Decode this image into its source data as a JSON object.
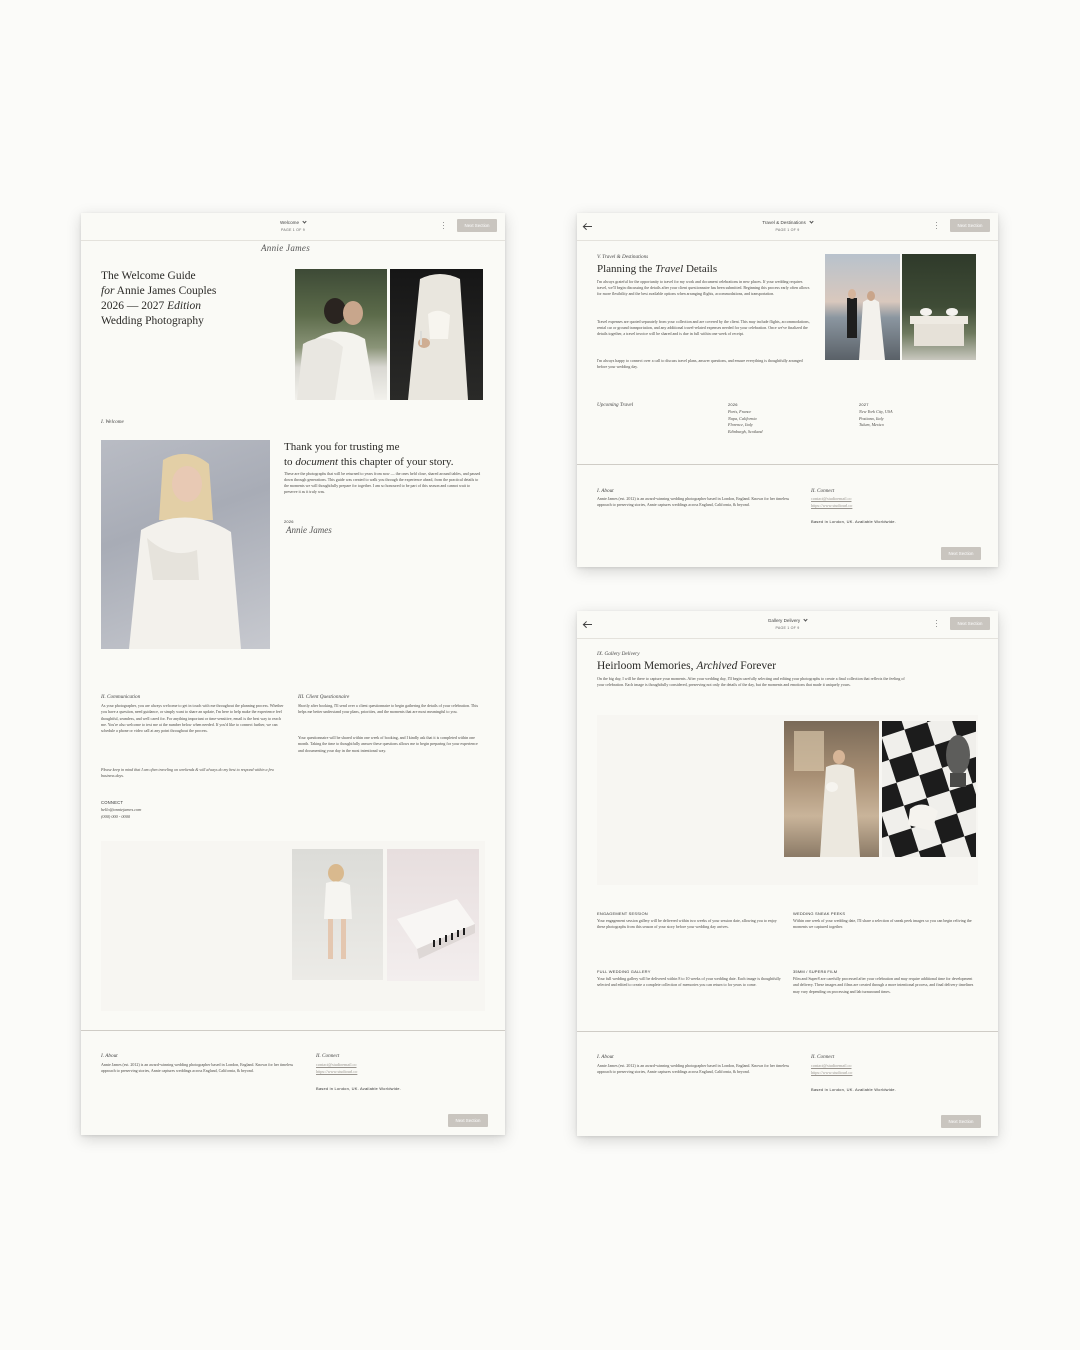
{
  "panels": {
    "welcome": {
      "header": {
        "title": "Welcome",
        "page": "PAGE 1 OF 9",
        "next_label": "Next Section"
      },
      "signature_logo": "Annie James",
      "hero": {
        "line1": "The Welcome Guide",
        "line2_italic": "for",
        "line2_rest": " Annie James Couples",
        "line3_plain": "2026 — 2027 ",
        "line3_italic": "Edition",
        "line4": "Wedding Photography"
      },
      "welcome_label": "I. Welcome",
      "thank_you": {
        "line1": "Thank you for trusting me",
        "line2_pre": "to ",
        "line2_italic": "document",
        "line2_post": " this chapter of your story.",
        "body": "These are the photographs that will be returned to years from now — the ones held close, shared around tables, and passed down through generations. This guide was created to walk you through the experience ahead, from the practical details to the moments we will thoughtfully prepare for together. I am so honoured to be part of this season and cannot wait to preserve it as it truly was.",
        "year": "2026",
        "signature": "Annie James"
      },
      "communication": {
        "label": "II. Communication",
        "body": "As your photographer, you are always welcome to get in touch with me throughout the planning process. Whether you have a question, need guidance, or simply want to share an update, I'm here to help make the experience feel thoughtful, seamless, and well cared for. For anything important or time-sensitive, email is the best way to reach me. You're also welcome to text me at the number below when needed. If you'd like to connect further, we can schedule a phone or video call at any point throughout the process.",
        "note": "Please keep in mind that I am often traveling on weekends & will always do my best to respond within a few business days."
      },
      "questionnaire": {
        "label": "III. Client Questionnaire",
        "body1": "Shortly after booking, I'll send over a client questionnaire to begin gathering the details of your celebration. This helps me better understand your plans, priorities, and the moments that are most meaningful to you.",
        "body2": "Your questionnaire will be shared within one week of booking, and I kindly ask that it is completed within one month. Taking the time to thoughtfully answer these questions allows me to begin preparing for your experience and documenting your day in the most intentional way."
      },
      "connect": {
        "label": "CONNECT",
        "email": "hello@anniejames.com",
        "phone": "(000) 000 - 0000"
      },
      "footer": {
        "about_label": "I. About",
        "about_text": "Annie James (est. 2012) is an award-winning wedding photographer based in London, England. Known for her timeless approach to preserving stories, Annie captures weddings across England, California, & beyond.",
        "connect_label": "II. Connect",
        "connect_email": "contact@studioemail.co",
        "connect_site": "https://www.studiourl.co",
        "based": "Based in London, UK. Available Worldwide."
      }
    },
    "travel": {
      "header": {
        "title": "Travel & Destinations",
        "page": "PAGE 1 OF 9",
        "next_label": "Next Section"
      },
      "label": "V. Travel & Destinations",
      "title_pre": "Planning the ",
      "title_italic": "Travel",
      "title_post": " Details",
      "body1": "I'm always grateful for the opportunity to travel for my work and document celebrations in new places. If your wedding requires travel, we'll begin discussing the details after your client questionnaire has been submitted. Beginning this process early often allows for more flexibility and the best available options when arranging flights, accommodations, and transportation.",
      "body2": "Travel expenses are quoted separately from your collection and are covered by the client. This may include flights, accommodations, rental car or ground transportation, and any additional travel-related expenses needed for your celebration. Once we've finalized the details together, a travel invoice will be shared and is due in full within one week of receipt.",
      "body3": "I'm always happy to connect over a call to discuss travel plans, answer questions, and ensure everything is thoughtfully arranged before your wedding day.",
      "upcoming_label": "Upcoming Travel",
      "year_a": "2026",
      "places_a": [
        "Paris, France",
        "Napa, California",
        "Florence, Italy",
        "Edinburgh, Scotland"
      ],
      "year_b": "2027",
      "places_b": [
        "New York City, USA",
        "Positano, Italy",
        "Tulum, Mexico"
      ],
      "footer": {
        "about_label": "I. About",
        "about_text": "Annie James (est. 2012) is an award-winning wedding photographer based in London, England. Known for her timeless approach to preserving stories, Annie captures weddings across England, California, & beyond.",
        "connect_label": "II. Connect",
        "connect_email": "contact@studioemail.co",
        "connect_site": "https://www.studiourl.co",
        "based": "Based in London, UK. Available Worldwide."
      }
    },
    "gallery": {
      "header": {
        "title": "Gallery Delivery",
        "page": "PAGE 1 OF 9",
        "next_label": "Next Section"
      },
      "label": "IX. Gallery Delivery",
      "title_pre": "Heirloom Memories, ",
      "title_italic": "Archived",
      "title_post": " Forever",
      "body": "On the big day, I will be there to capture your moments. After your wedding day, I'll begin carefully selecting and editing your photographs to create a final collection that reflects the feeling of your celebration. Each image is thoughtfully considered, preserving not only the details of the day, but the moments and emotions that made it uniquely yours.",
      "items": [
        {
          "title": "ENGAGEMENT SESSION",
          "text": "Your engagement session gallery will be delivered within two weeks of your session date, allowing you to enjoy these photographs from this season of your story before your wedding day arrives."
        },
        {
          "title": "WEDDING SNEAK PEEKS",
          "text": "Within one week of your wedding date, I'll share a selection of sneak peek images so you can begin reliving the moments we captured together."
        },
        {
          "title": "FULL WEDDING GALLERY",
          "text": "Your full wedding gallery will be delivered within 8 to 10 weeks of your wedding date. Each image is thoughtfully selected and edited to create a complete collection of memories you can return to for years to come."
        },
        {
          "title": "35MM / SUPER8 FILM",
          "text": "Film and Super8 are carefully processed after your celebration and may require additional time for development and delivery. These images and films are created through a more intentional process, and final delivery timelines may vary depending on processing and lab turnaround times."
        }
      ],
      "footer": {
        "about_label": "I. About",
        "about_text": "Annie James (est. 2012) is an award-winning wedding photographer based in London, England. Known for her timeless approach to preserving stories, Annie captures weddings across England, California, & beyond.",
        "connect_label": "II. Connect",
        "connect_email": "contact@studioemail.co",
        "connect_site": "https://www.studiourl.co",
        "based": "Based in London, UK. Available Worldwide."
      }
    }
  },
  "colors": {
    "button": "#c9c5bf",
    "page": "#fafaf6",
    "text": "#2b2a27"
  }
}
